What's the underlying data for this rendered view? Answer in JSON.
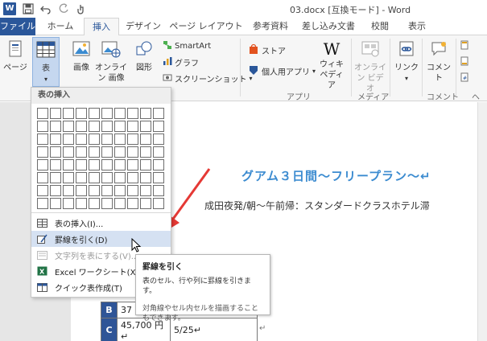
{
  "titlebar": {
    "app_icon": "W",
    "title": "03.docx [互換モード] - Word",
    "icons": [
      "save-icon",
      "undo-icon",
      "redo-icon",
      "touch-icon"
    ]
  },
  "tabs": [
    "ファイル",
    "ホーム",
    "挿入",
    "デザイン",
    "ページ レイアウト",
    "参考資料",
    "差し込み文書",
    "校閲",
    "表示"
  ],
  "active_tab": "挿入",
  "ribbon": {
    "page_label": "ページ",
    "table_label": "表",
    "image_label": "画像",
    "online_image_label": "オンライン 画像",
    "shape_label": "図形",
    "smartart_label": "SmartArt",
    "graph_label": "グラフ",
    "screenshot_label": "スクリーンショット",
    "store_label": "ストア",
    "personal_apps_label": "個人用アプリ",
    "wiki_label": "ウィキ ペディア",
    "online_video_label": "オンライン ビデオ",
    "link_label": "リンク",
    "comment_label": "コメント",
    "group_apps": "アプリ",
    "group_media": "メディア",
    "group_comment": "コメント",
    "group_header": "ヘ"
  },
  "dropdown": {
    "header": "表の挿入",
    "items": [
      {
        "label": "表の挿入(I)...",
        "state": "normal"
      },
      {
        "label": "罫線を引く(D)",
        "state": "highlighted"
      },
      {
        "label": "文字列を表にする(V)...",
        "state": "disabled"
      },
      {
        "label": "Excel ワークシート(X)",
        "state": "normal"
      },
      {
        "label": "クイック表作成(T)",
        "state": "normal"
      }
    ]
  },
  "tooltip": {
    "title": "罫線を引く",
    "line1": "表のセル、行や列に罫線を引きます。",
    "line2": "対角線やセル内セルを描画することもできます。"
  },
  "document": {
    "heading": "グアム３日間〜フリープラン〜↵",
    "subline": "成田夜発/朝〜午前帰：スタンダードクラスホテル滞",
    "table_rows": [
      {
        "head": "B",
        "price": "37",
        "date": ""
      },
      {
        "head": "C",
        "price": "45,700 円↵",
        "date": "5/25↵"
      }
    ],
    "table_mark": "↵"
  },
  "colors": {
    "accent": "#2b579a",
    "heading": "#3b8bd0",
    "arrow": "#e53935",
    "table_head": "#2f5597"
  }
}
